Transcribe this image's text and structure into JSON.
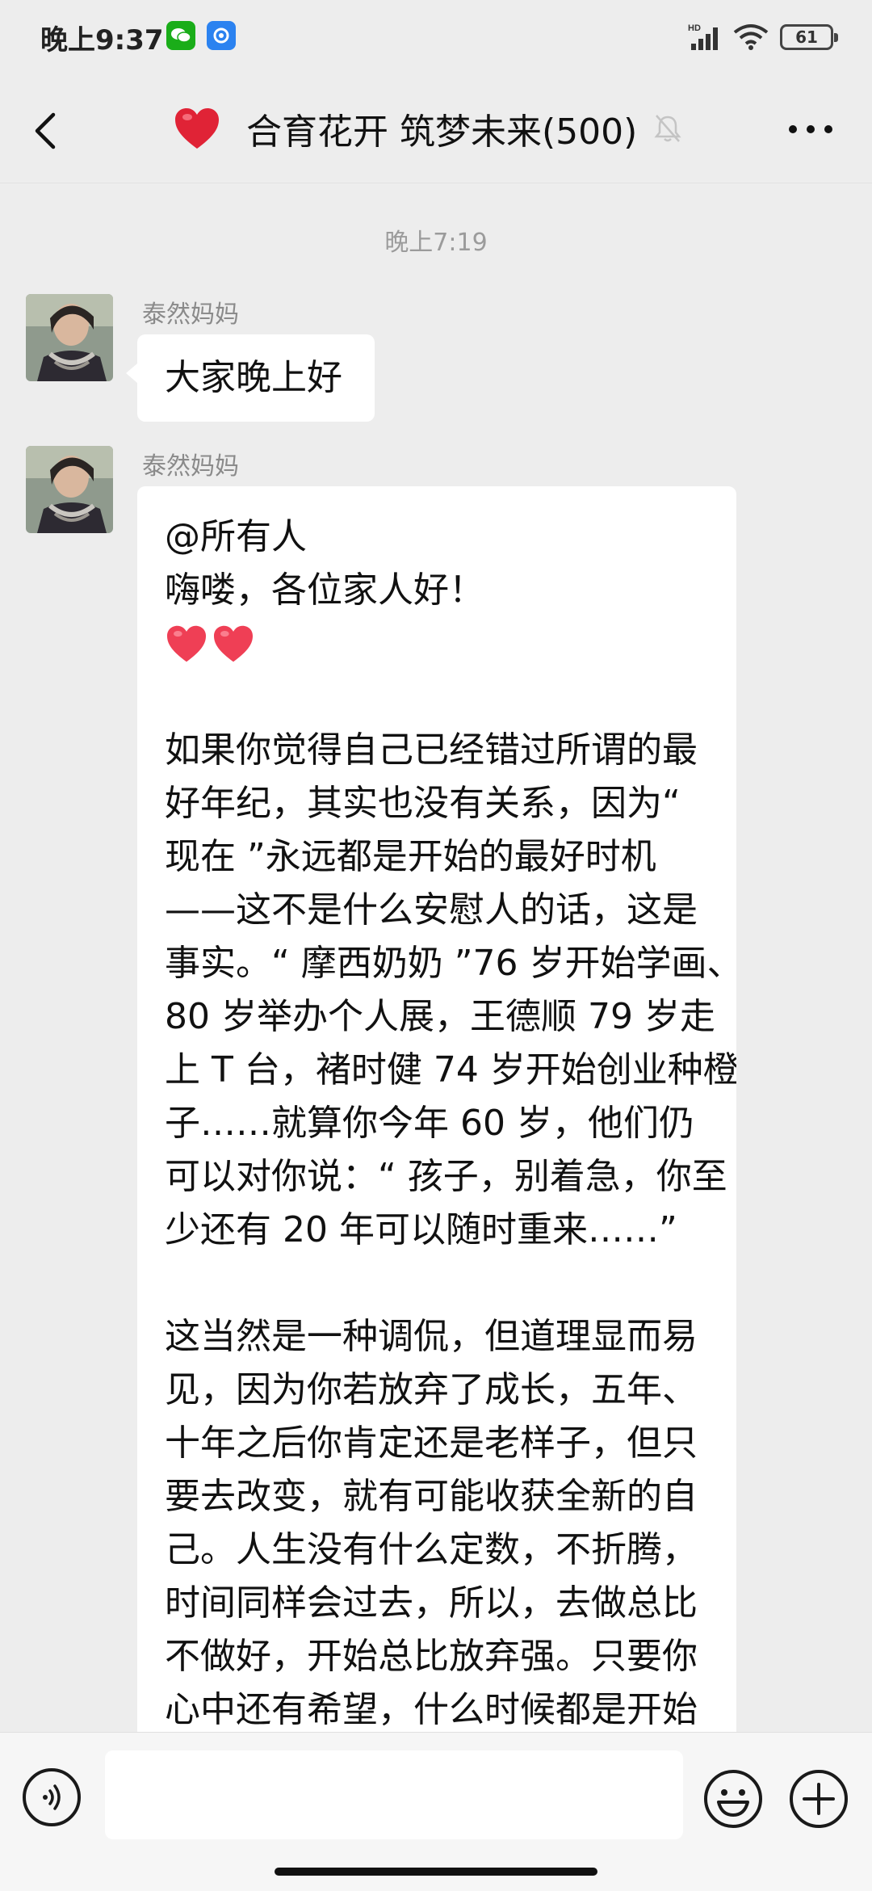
{
  "status_bar": {
    "time": "晚上9:37",
    "network": "HD",
    "battery": "61",
    "app_icons": [
      "wechat-icon",
      "app-icon"
    ]
  },
  "header": {
    "title": "合育花开 筑梦未来(500)",
    "icons": [
      "back-icon",
      "heart-icon",
      "mute-icon",
      "more-icon"
    ]
  },
  "chat": {
    "timestamp": "晚上7:19",
    "messages": [
      {
        "sender": "泰然妈妈",
        "lines": [
          "大家晚上好"
        ]
      },
      {
        "sender": "泰然妈妈",
        "lines": [
          "@所有人",
          "嗨喽，各位家人好！",
          "[hearts]",
          "",
          "如果你觉得自己已经错过所谓的最",
          "好年纪，其实也没有关系，因为“",
          "现在 ”永远都是开始的最好时机",
          "——这不是什么安慰人的话，这是",
          "事实。“ 摩西奶奶 ”76 岁开始学画、",
          "80 岁举办个人展，王德顺 79 岁走",
          "上 T 台，褚时健 74 岁开始创业种橙",
          "子……就算你今年 60 岁，他们仍",
          "可以对你说：“ 孩子，别着急，你至",
          "少还有 20 年可以随时重来……”",
          "",
          "这当然是一种调侃，但道理显而易",
          "见，因为你若放弃了成长，五年、",
          "十年之后你肯定还是老样子，但只",
          "要去改变，就有可能收获全新的自",
          "己。人生没有什么定数，不折腾，",
          "时间同样会过去，所以，去做总比",
          "不做好，开始总比放弃强。只要你",
          "心中还有希望，什么时候都是开始"
        ]
      }
    ]
  },
  "input_bar": {
    "placeholder": "",
    "icons": [
      "voice-icon",
      "emoji-icon",
      "plus-icon"
    ]
  },
  "colors": {
    "background": "#ededed",
    "bubble": "#ffffff",
    "heart": "#e8374b",
    "wechat_green": "#1aad19"
  }
}
